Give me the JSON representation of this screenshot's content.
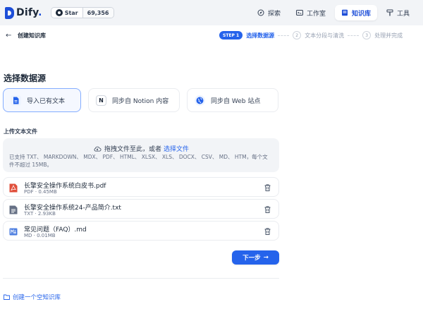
{
  "header": {
    "logo_text": "Dify",
    "logo_dot": ".",
    "github": {
      "star_label": "Star",
      "count": "69,356"
    },
    "nav": [
      {
        "label": "探索",
        "icon": "compass-icon",
        "active": false
      },
      {
        "label": "工作室",
        "icon": "terminal-icon",
        "active": false
      },
      {
        "label": "知识库",
        "icon": "book-icon",
        "active": true
      },
      {
        "label": "工具",
        "icon": "hammer-icon",
        "active": false
      }
    ]
  },
  "subheader": {
    "back_label": "创建知识库",
    "steps": [
      {
        "badge": "STEP 1",
        "label": "选择数据源",
        "active": true
      },
      {
        "badge": "2",
        "label": "文本分段与清洗",
        "active": false
      },
      {
        "badge": "3",
        "label": "处理并完成",
        "active": false
      }
    ]
  },
  "main": {
    "section_title": "选择数据源",
    "sources": [
      {
        "label": "导入已有文本",
        "icon": "document-icon",
        "active": true
      },
      {
        "label": "同步自 Notion 内容",
        "icon": "notion-icon",
        "active": false
      },
      {
        "label": "同步自 Web 站点",
        "icon": "globe-icon",
        "active": false
      }
    ],
    "upload_title": "上传文本文件",
    "dropzone": {
      "prompt": "拖拽文件至此，或者",
      "link": "选择文件",
      "supported": "已支持 TXT、 MARKDOWN、 MDX、 PDF、 HTML、 XLSX、 XLS、 DOCX、 CSV、 MD、 HTM，每个文件不超过 15MB。"
    },
    "files": [
      {
        "name": "长擎安全操作系统白皮书.pdf",
        "meta": "PDF · 0.45MB",
        "icon": "pdf-file-icon",
        "color": "#e04f3b"
      },
      {
        "name": "长擎安全操作系统24-产品简介.txt",
        "meta": "TXT · 2.93KB",
        "icon": "txt-file-icon",
        "color": "#667085"
      },
      {
        "name": "常见问题（FAQ）.md",
        "meta": "MD · 0.01MB",
        "icon": "md-file-icon",
        "color": "#4e7fe0"
      }
    ],
    "next_label": "下一步",
    "next_arrow": "→",
    "empty_kb_link": "创建一个空知识库"
  },
  "colors": {
    "accent": "#2563eb",
    "topbar_bg": "#f2f4f7"
  }
}
